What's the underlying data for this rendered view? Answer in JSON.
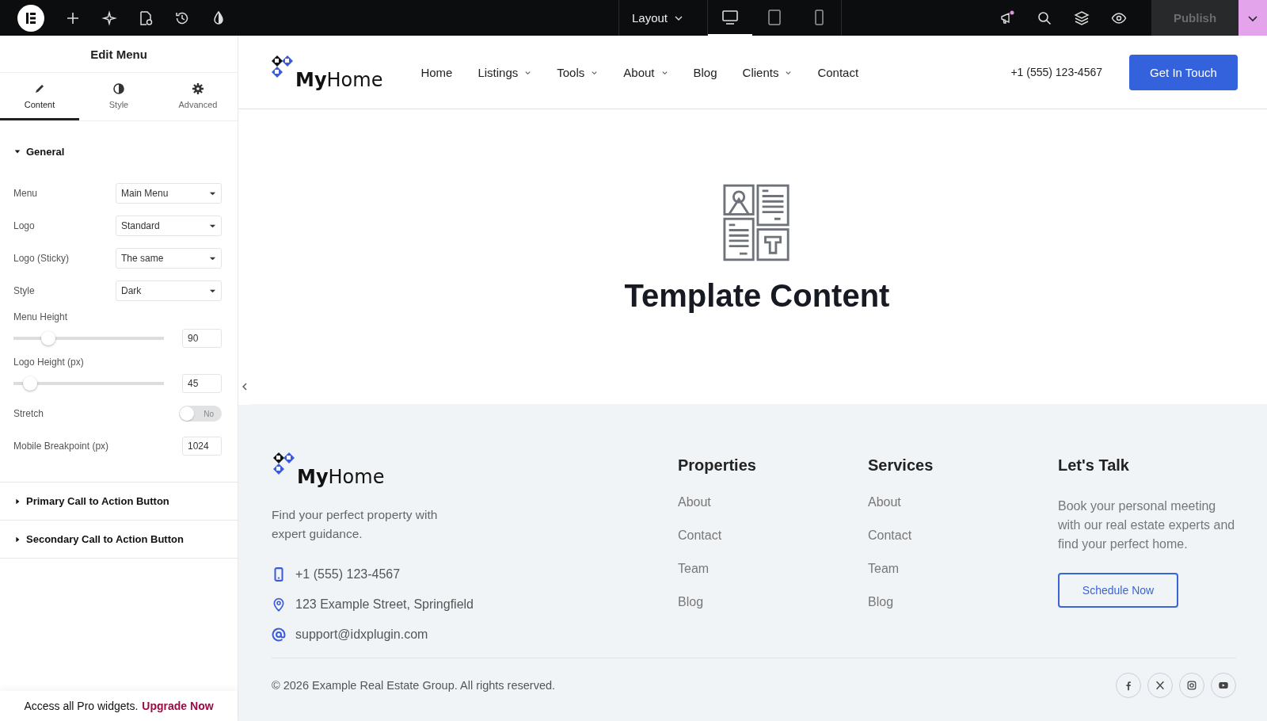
{
  "toolbar": {
    "layout_menu": "Layout",
    "devices": [
      {
        "kind": "desktop",
        "selected": true
      },
      {
        "kind": "tablet",
        "selected": false
      },
      {
        "kind": "mobile",
        "selected": false
      }
    ],
    "notification": true,
    "publish": {
      "label": "Publish",
      "disabled": true
    }
  },
  "panel": {
    "title": "Edit Menu",
    "tabs": [
      {
        "label": "Content",
        "kind": "pencil",
        "selected": true
      },
      {
        "label": "Style",
        "kind": "contrast",
        "selected": false
      },
      {
        "label": "Advanced",
        "kind": "gear",
        "selected": false
      }
    ],
    "sections": [
      {
        "title": "General",
        "expanded": true,
        "controls": [
          {
            "kind": "select",
            "label": "Menu",
            "value": "Main Menu"
          },
          {
            "kind": "select",
            "label": "Logo",
            "value": "Standard"
          },
          {
            "kind": "select",
            "label": "Logo (Sticky)",
            "value": "The same"
          },
          {
            "kind": "select",
            "label": "Style",
            "value": "Dark"
          },
          {
            "kind": "slider",
            "label": "Menu Height",
            "level": 0.23,
            "value": "90"
          },
          {
            "kind": "slider",
            "label": "Logo Height (px)",
            "level": 0.11,
            "value": "45"
          },
          {
            "kind": "toggle",
            "label": "Stretch",
            "on": false,
            "value": "No"
          },
          {
            "kind": "number",
            "label": "Mobile Breakpoint (px)",
            "value": "1024"
          }
        ]
      },
      {
        "title": "Primary Call to Action Button",
        "expanded": false
      },
      {
        "title": "Secondary Call to Action Button",
        "expanded": false
      }
    ],
    "promo": {
      "text": "Access all Pro widgets.",
      "link": "Upgrade Now"
    }
  },
  "header": {
    "logo": "**My**Home",
    "nav": [
      {
        "label": "Home",
        "has_dropdown": false
      },
      {
        "label": "Listings",
        "has_dropdown": true
      },
      {
        "label": "Tools",
        "has_dropdown": true
      },
      {
        "label": "About",
        "has_dropdown": true
      },
      {
        "label": "Blog",
        "has_dropdown": false
      },
      {
        "label": "Clients",
        "has_dropdown": true
      },
      {
        "label": "Contact",
        "has_dropdown": false
      }
    ],
    "phone": "+1 (555) 123-4567",
    "cta": "Get In Touch"
  },
  "template": {
    "title": "Template Content"
  },
  "footer": {
    "logo": "**My**Home",
    "tagline": "Find your perfect property with expert guidance.",
    "contacts": [
      {
        "kind": "phone",
        "text": "+1 (555) 123-4567"
      },
      {
        "kind": "location",
        "text": "123 Example Street, Springfield"
      },
      {
        "kind": "email",
        "text": "support@idxplugin.com"
      }
    ],
    "columns": [
      {
        "title": "Properties",
        "links": [
          "About",
          "Contact",
          "Team",
          "Blog"
        ]
      },
      {
        "title": "Services",
        "links": [
          "About",
          "Contact",
          "Team",
          "Blog"
        ]
      }
    ],
    "talk": {
      "title": "Let's Talk",
      "text": "Book your personal meeting with our real estate experts and find your perfect home.",
      "button": "Schedule Now"
    },
    "copyright": "© 2026 Example Real Estate Group. All rights reserved."
  }
}
